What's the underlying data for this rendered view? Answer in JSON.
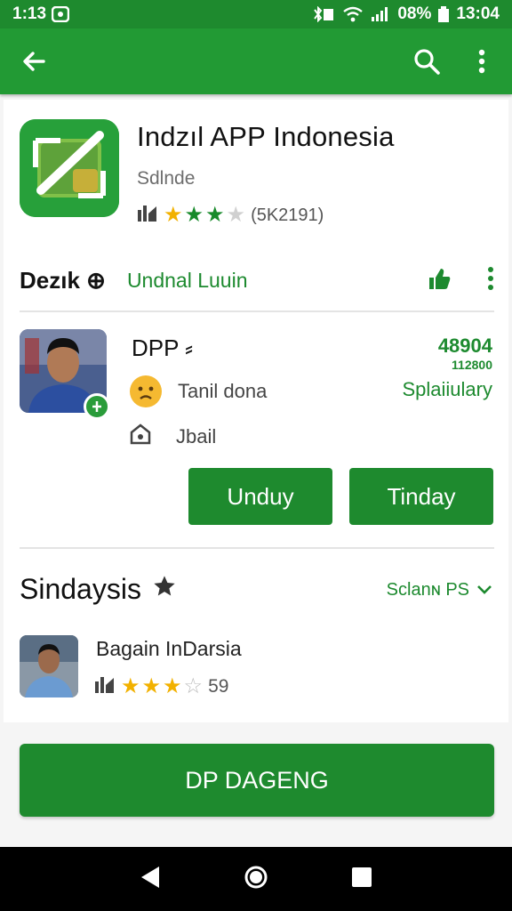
{
  "status_bar": {
    "time_left": "1:13",
    "battery": "08%",
    "time_right": "13:04"
  },
  "app_bar": {
    "back_icon": "back-arrow-icon",
    "search_icon": "search-icon",
    "more_icon": "more-vert-icon"
  },
  "app": {
    "title": "Indzıl APP Indonesia",
    "developer": "Sdlnde",
    "rating_count": "(5K2191)",
    "stars": 3
  },
  "section1": {
    "title": "Dezık ⊕",
    "link": "Undnal Luuin"
  },
  "person": {
    "name": "DPP ⸗",
    "line1": "Tanil dona",
    "line2": "Jbail",
    "number_big": "48904",
    "number_small": "112800",
    "status": "Splaiiulary"
  },
  "buttons": {
    "first": "Unduy",
    "second": "Tinday"
  },
  "section2": {
    "title": "Sindaysis",
    "link": "Sclanɴ PS"
  },
  "item2": {
    "name": "Bagain InDarsia",
    "rating_count": "59",
    "stars": 3
  },
  "primary_button": {
    "label": "DP DAGENG"
  },
  "colors": {
    "primary": "#1e8a2e",
    "app_bar": "#229a34",
    "star": "#f2b100"
  }
}
